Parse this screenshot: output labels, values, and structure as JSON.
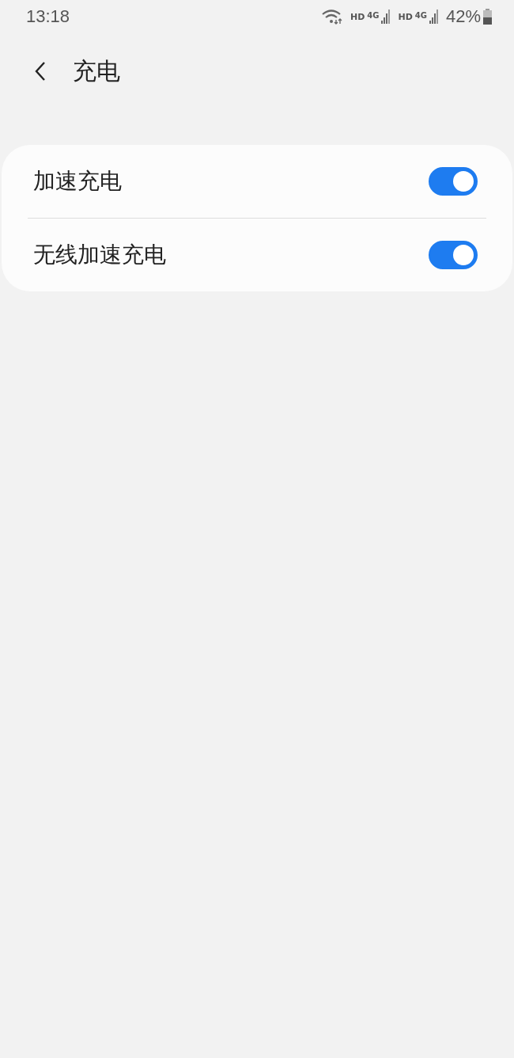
{
  "status_bar": {
    "time": "13:18",
    "networks": [
      {
        "hd": "HD",
        "type": "4G"
      },
      {
        "hd": "HD",
        "type": "4G"
      }
    ],
    "battery": "42%"
  },
  "header": {
    "title": "充电"
  },
  "settings": [
    {
      "label": "加速充电",
      "on": true
    },
    {
      "label": "无线加速充电",
      "on": true
    }
  ]
}
